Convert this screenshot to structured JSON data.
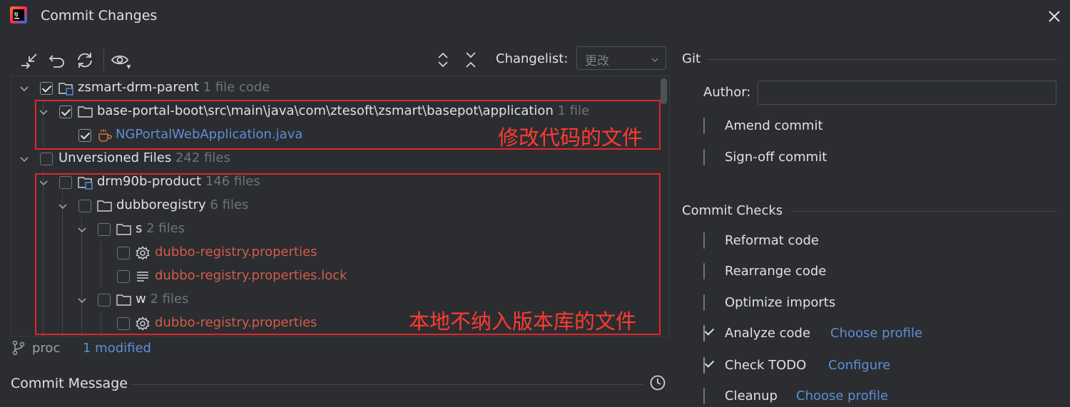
{
  "window": {
    "title": "Commit Changes"
  },
  "changelist": {
    "label": "Changelist:",
    "value": "更改"
  },
  "tree": {
    "rows": [
      {
        "name": "zsmart-drm-parent",
        "count": "1 file",
        "extra": "code"
      },
      {
        "name": "base-portal-boot\\src\\main\\java\\com\\ztesoft\\zsmart\\basepot\\application",
        "count": "1 file"
      },
      {
        "name": "NGPortalWebApplication.java"
      },
      {
        "name": "Unversioned Files",
        "count": "242 files"
      },
      {
        "name": "drm90b-product",
        "count": "146 files"
      },
      {
        "name": "dubboregistry",
        "count": "6 files"
      },
      {
        "name": "s",
        "count": "2 files"
      },
      {
        "name": "dubbo-registry.properties"
      },
      {
        "name": "dubbo-registry.properties.lock"
      },
      {
        "name": "w",
        "count": "2 files"
      },
      {
        "name": "dubbo-registry.properties"
      }
    ]
  },
  "annotations": {
    "modified": "修改代码的文件",
    "unversioned": "本地不纳入版本库的文件"
  },
  "status": {
    "branch": "proc",
    "modified": "1 modified"
  },
  "commit_message": {
    "label": "Commit Message"
  },
  "git": {
    "title": "Git",
    "author_label": "Author:",
    "author_value": "",
    "amend": "Amend commit",
    "signoff": "Sign-off commit"
  },
  "checks": {
    "title": "Commit Checks",
    "reformat": "Reformat code",
    "rearrange": "Rearrange code",
    "optimize": "Optimize imports",
    "analyze": "Analyze code",
    "analyze_link": "Choose profile",
    "todo": "Check TODO",
    "todo_link": "Configure",
    "cleanup": "Cleanup",
    "cleanup_link": "Choose profile"
  },
  "colors": {
    "background": "#2b2d30",
    "link": "#5c8fd6",
    "unversioned": "#d45b4b",
    "annotation": "#ff3b30"
  }
}
